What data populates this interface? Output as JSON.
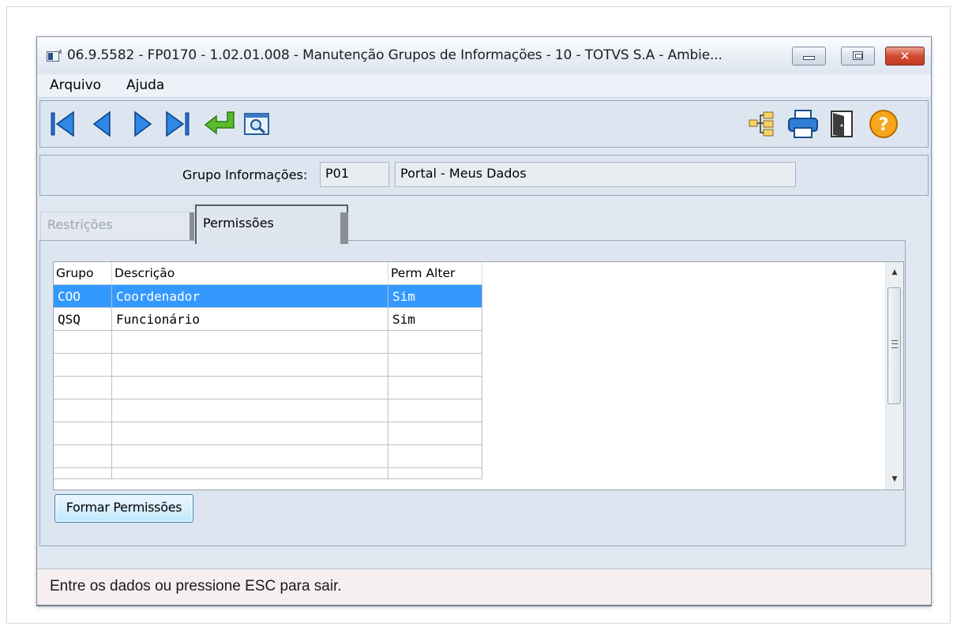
{
  "window": {
    "title": "06.9.5582 - FP0170 - 1.02.01.008 - Manutenção Grupos de Informações - 10 - TOTVS S.A - Ambie...",
    "close_glyph": "✕"
  },
  "menu": {
    "items": [
      "Arquivo",
      "Ajuda"
    ]
  },
  "toolbar": {
    "left_icons": [
      "first-record-icon",
      "previous-record-icon",
      "next-record-icon",
      "last-record-icon",
      "return-icon",
      "search-zoom-icon"
    ],
    "right_icons": [
      "tree-structure-icon",
      "printer-icon",
      "exit-door-icon",
      "help-icon"
    ]
  },
  "grupo": {
    "label": "Grupo Informações:",
    "code": "P01",
    "description": "Portal - Meus Dados"
  },
  "tabs": [
    {
      "label": "Restrições",
      "active": false
    },
    {
      "label": "Permissões",
      "active": true
    }
  ],
  "table": {
    "columns": [
      "Grupo",
      "Descrição",
      "Perm Alter"
    ],
    "rows": [
      {
        "grupo": "COO",
        "descricao": "Coordenador",
        "perm": "Sim"
      },
      {
        "grupo": "QSQ",
        "descricao": "Funcionário",
        "perm": "Sim"
      }
    ],
    "selected_row": 0
  },
  "buttons": {
    "formar_permissoes": "Formar Permissões"
  },
  "status": {
    "message": "Entre os dados ou pressione ESC para sair."
  },
  "colors": {
    "selection": "#3399ff",
    "accent_green": "#4caf2f",
    "nav_blue": "#1e6fd0",
    "help_orange": "#f5a623"
  }
}
